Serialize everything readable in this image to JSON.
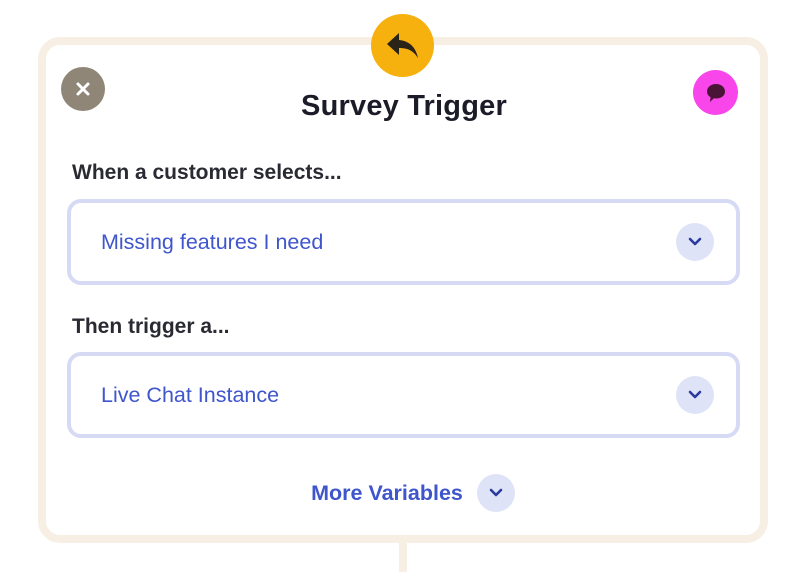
{
  "dialog": {
    "title": "Survey Trigger",
    "reply_icon": "reply-arrow-icon",
    "close_icon": "close-x-icon",
    "chat_icon": "chat-bubble-icon"
  },
  "trigger": {
    "when_label": "When a customer selects...",
    "when_value": "Missing features I need",
    "then_label": "Then trigger a...",
    "then_value": "Live Chat Instance"
  },
  "more": {
    "label": "More Variables",
    "icon": "chevron-down-icon"
  },
  "colors": {
    "accent_blue": "#3f55cc",
    "reply_badge": "#f6b10e",
    "chat_badge": "#f846ea",
    "close_badge": "#8f8677",
    "card_border": "#f7efe3",
    "select_border": "#d6daf5"
  }
}
